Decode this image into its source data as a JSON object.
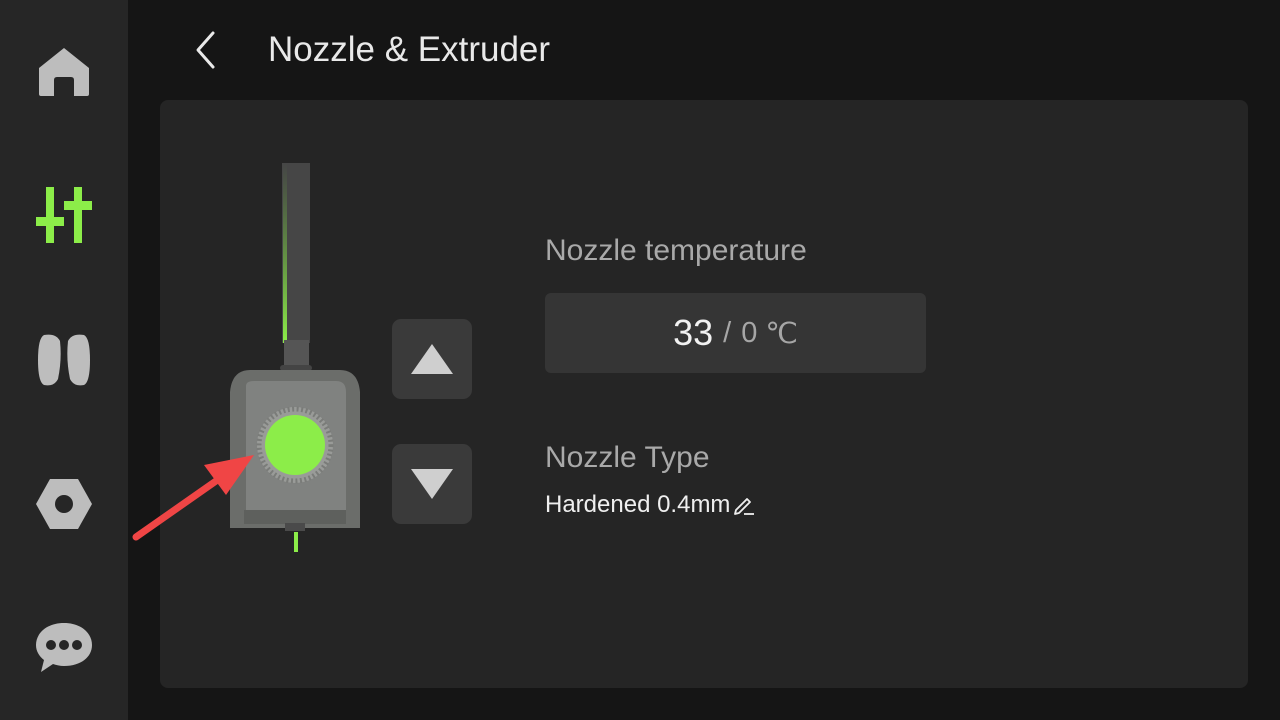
{
  "header": {
    "title": "Nozzle & Extruder",
    "back_icon": "chevron-left-icon"
  },
  "sidebar": {
    "items": [
      {
        "name": "home",
        "icon": "home-icon",
        "active": false
      },
      {
        "name": "controls",
        "icon": "sliders-icon",
        "active": true
      },
      {
        "name": "filament",
        "icon": "filament-spool-icon",
        "active": false
      },
      {
        "name": "settings",
        "icon": "hex-nut-icon",
        "active": false
      },
      {
        "name": "messages",
        "icon": "chat-bubble-icon",
        "active": false
      }
    ]
  },
  "extruder": {
    "up_icon": "triangle-up-icon",
    "down_icon": "triangle-down-icon"
  },
  "nozzle_temperature": {
    "label": "Nozzle temperature",
    "current": "33",
    "separator": "/",
    "target": "0",
    "unit": "℃"
  },
  "nozzle_type": {
    "label": "Nozzle Type",
    "value": "Hardened 0.4mm",
    "edit_icon": "pencil-icon"
  },
  "colors": {
    "accent": "#8ced49",
    "sidebar_bg": "#262626",
    "panel_bg": "#252525",
    "annotation_arrow": "#f04545"
  }
}
